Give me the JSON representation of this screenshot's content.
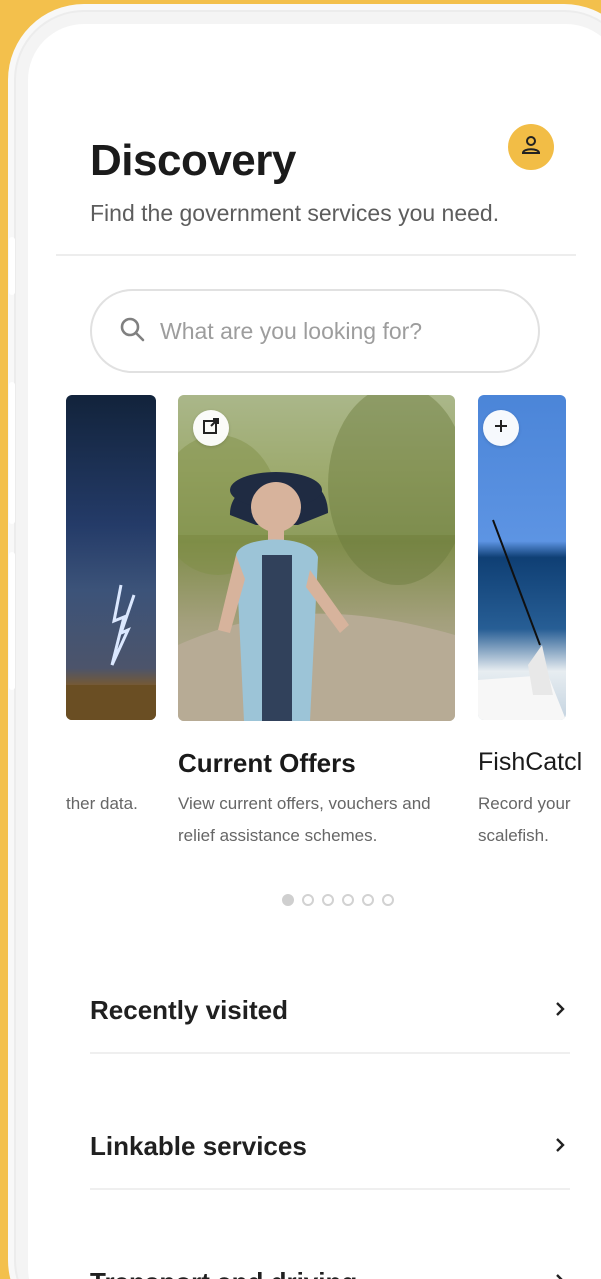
{
  "header": {
    "title": "Discovery",
    "subtitle": "Find the government services you need."
  },
  "search": {
    "placeholder": "What are you looking for?"
  },
  "carousel": {
    "cards": [
      {
        "title": "",
        "description_line1": "ther data.",
        "description_line2": ""
      },
      {
        "title": "Current Offers",
        "description_line1": "View current offers, vouchers and",
        "description_line2": "relief assistance schemes."
      },
      {
        "title": "FishCatcl",
        "description_line1": "Record your",
        "description_line2": "scalefish."
      }
    ],
    "dots_count": 6,
    "active_dot_index": 0
  },
  "list": {
    "items": [
      {
        "label": "Recently visited"
      },
      {
        "label": "Linkable services"
      },
      {
        "label": "Transport and driving"
      }
    ]
  },
  "colors": {
    "accent": "#f2bd46",
    "background": "#f3c04c",
    "title_text": "#1b1b1b",
    "subtitle_text": "#5d5d5d"
  },
  "icons": {
    "avatar": "user-icon",
    "search": "search-icon",
    "card_external": "external-link-icon",
    "card_add": "plus-icon",
    "chevron": "chevron-right-icon"
  }
}
